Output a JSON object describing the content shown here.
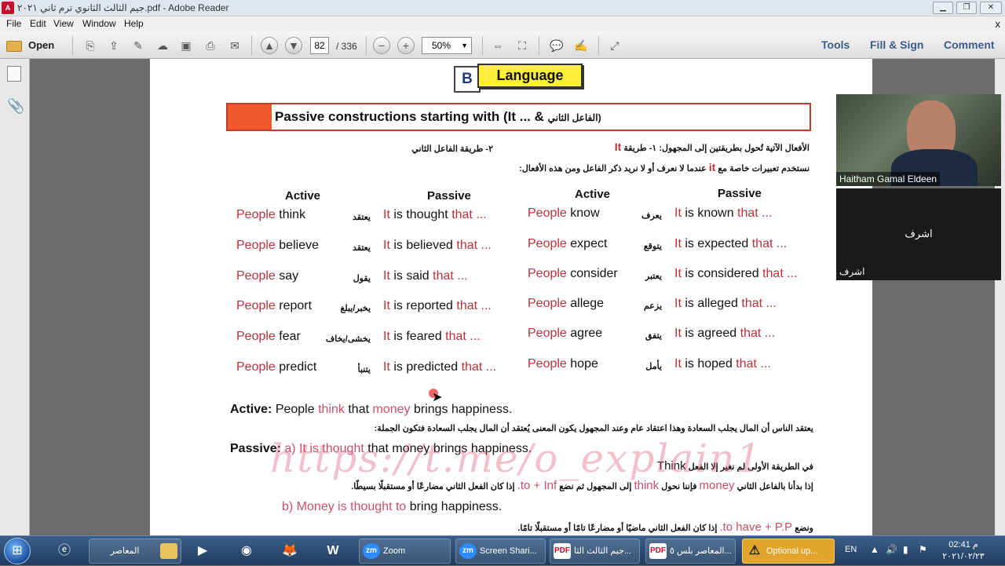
{
  "window": {
    "title": "جيم الثالث الثانوي ترم ثاني ٢٠٢١.pdf - Adobe Reader",
    "icon": "pdf-icon"
  },
  "menu": {
    "items": [
      "File",
      "Edit",
      "View",
      "Window",
      "Help"
    ],
    "close_glyph": "x"
  },
  "toolbar": {
    "open_label": "Open",
    "page_current": "82",
    "page_total": "/ 336",
    "zoom": "50%",
    "tools_label": "Tools",
    "fillsign_label": "Fill & Sign",
    "comment_label": "Comment"
  },
  "document": {
    "section_letter": "B",
    "section_title": "Language",
    "heading": "Passive constructions starting with (It ... &",
    "heading_arabic": "الفاعل الثاني)",
    "intro_line1_a": "الأفعال الآتية تُحول بطريقتين إلى المجهول: ١- طريقة",
    "intro_line1_it": "It",
    "intro_line1_b": "٢- طريقة الفاعل الثاني",
    "intro_line2_a": "نستخدم تعبيرات خاصة مع",
    "intro_line2_it": "it",
    "intro_line2_b": "عندما لا نعرف أو لا نريد ذكر الفاعل ومن هذه الأفعال:",
    "col_active": "Active",
    "col_passive": "Passive",
    "left_rows": [
      {
        "people": "People",
        "verb": "think",
        "arabic": "يعتقد",
        "it": "It",
        "passive": "is thought",
        "that": "that ..."
      },
      {
        "people": "People",
        "verb": "believe",
        "arabic": "يعتقد",
        "it": "It",
        "passive": "is believed",
        "that": "that ..."
      },
      {
        "people": "People",
        "verb": "say",
        "arabic": "يقول",
        "it": "It",
        "passive": "is said",
        "that": "that ..."
      },
      {
        "people": "People",
        "verb": "report",
        "arabic": "يخبر/يبلغ",
        "it": "It",
        "passive": "is reported",
        "that": "that ..."
      },
      {
        "people": "People",
        "verb": "fear",
        "arabic": "يخشى/يخاف",
        "it": "It",
        "passive": "is feared",
        "that": "that ..."
      },
      {
        "people": "People",
        "verb": "predict",
        "arabic": "يتنبأ",
        "it": "It",
        "passive": "is predicted",
        "that": "that ..."
      }
    ],
    "right_rows": [
      {
        "people": "People",
        "verb": "know",
        "arabic": "يعرف",
        "it": "It",
        "passive": "is known",
        "that": "that ..."
      },
      {
        "people": "People",
        "verb": "expect",
        "arabic": "يتوقع",
        "it": "It",
        "passive": "is expected",
        "that": "that ..."
      },
      {
        "people": "People",
        "verb": "consider",
        "arabic": "يعتبر",
        "it": "It",
        "passive": "is considered",
        "that": "that ..."
      },
      {
        "people": "People",
        "verb": "allege",
        "arabic": "يزعم",
        "it": "It",
        "passive": "is alleged",
        "that": "that ..."
      },
      {
        "people": "People",
        "verb": "agree",
        "arabic": "يتفق",
        "it": "It",
        "passive": "is agreed",
        "that": "that ..."
      },
      {
        "people": "People",
        "verb": "hope",
        "arabic": "يأمل",
        "it": "It",
        "passive": "is hoped",
        "that": "that ..."
      }
    ],
    "example_active_label": "Active:",
    "example_active_a": "People",
    "example_active_b": "think",
    "example_active_c": "that",
    "example_active_d": "money",
    "example_active_e": "brings happiness.",
    "note1": "يعتقد الناس أن المال يجلب السعادة وهذا اعتقاد عام وعند المجهول يكون المعنى يُعتقد أن المال يجلب السعادة فتكون الجملة:",
    "example_passive_label": "Passive:",
    "example_passive_a": "a)",
    "example_passive_b": "It is thought",
    "example_passive_c": "that money brings happiness.",
    "note2_a": "في الطريقة الأولى لم نغير إلا الفعل",
    "note2_think": "Think",
    "note3_a": "إذا بدأنا بالفاعل الثاني",
    "note3_money": "money",
    "note3_b": "فإننا نحول",
    "note3_think": "think",
    "note3_c": "إلى المجهول ثم نضع",
    "note3_inf": "to + Inf.",
    "note3_d": "إذا كان الفعل الثاني مضارعًا أو مستقبلًا بسيطًا.",
    "example_b_a": "b)",
    "example_b_b": "Money is thought to",
    "example_b_c": "bring happiness.",
    "note4_a": "ونضع",
    "note4_pp": "to have + P.P.",
    "note4_b": "إذا كان الفعل الثاني ماضيًا أو مضارعًا تامًا أو مستقبلًا تامًا.",
    "watermark": "https://t.me/o_explain1"
  },
  "video": {
    "participant1": "Haitham Gamal Eldeen",
    "participant2_center": "اشرف",
    "participant2_label": "اشرف"
  },
  "taskbar": {
    "items": [
      {
        "label": "المعاصر",
        "icon": "folder-icon"
      },
      {
        "label": "Zoom",
        "icon": "zoom-icon"
      },
      {
        "label": "Screen Shari...",
        "icon": "zoom-icon"
      },
      {
        "label": "جيم الثالث الثا...",
        "icon": "pdf-icon"
      },
      {
        "label": "المعاصر بلس ٥...",
        "icon": "pdf-icon"
      },
      {
        "label": "Optional up...",
        "icon": "warning-icon"
      }
    ],
    "lang": "EN",
    "time": "02:41 م",
    "date": "٢٠٢١/٠٢/٢٣"
  },
  "colors": {
    "accent_red": "#b8323c",
    "language_badge": "#ffee3a",
    "heading_orange": "#f0582c",
    "link_blue": "#3a5d8c"
  }
}
